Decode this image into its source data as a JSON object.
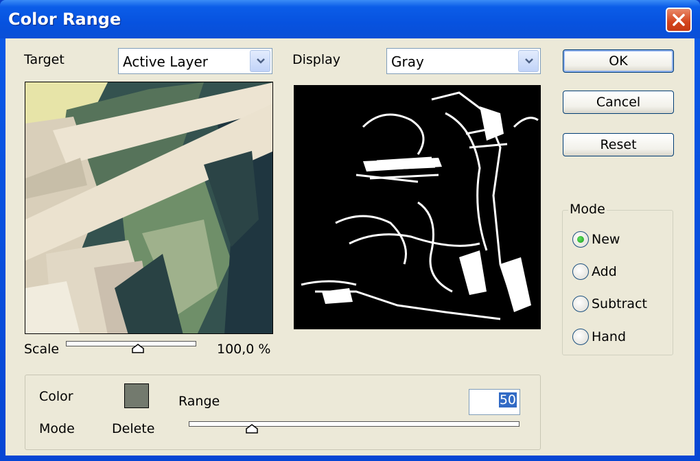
{
  "window": {
    "title": "Color Range"
  },
  "target": {
    "label": "Target",
    "value": "Active Layer"
  },
  "display": {
    "label": "Display",
    "value": "Gray"
  },
  "buttons": {
    "ok": "OK",
    "cancel": "Cancel",
    "reset": "Reset"
  },
  "scale": {
    "label": "Scale",
    "value": "100,0 %",
    "level": 0.55
  },
  "mode_group": {
    "title": "Mode",
    "options": [
      "New",
      "Add",
      "Subtract",
      "Hand"
    ],
    "selected": "New"
  },
  "bottom": {
    "color_label": "Color",
    "mode_label": "Mode",
    "delete_label": "Delete",
    "range_label": "Range",
    "range_value": "50",
    "range_level": 0.19,
    "swatch_color": "#737a6e"
  },
  "colors": {
    "accent": "#316ac5",
    "titlebar": "#0a54e0",
    "close": "#d4441c"
  },
  "icons": [
    "close-icon",
    "chevron-down-icon",
    "slider-thumb-icon"
  ]
}
